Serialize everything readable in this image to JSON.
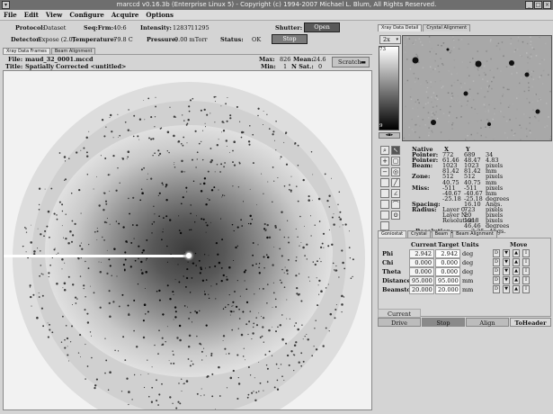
{
  "window": {
    "title": "marccd   v0.16.3b (Enterprise Linux 5) - Copyright (c) 1994-2007 Michael L. Blum, All Rights Reserved."
  },
  "menu": [
    "File",
    "Edit",
    "View",
    "Configure",
    "Acquire",
    "Options"
  ],
  "info": {
    "protocol_label": "Protocol:",
    "protocol_value": "Dataset",
    "seqfrm_label": "Seq:Frm:",
    "seqfrm_value": "40:6",
    "intensity_label": "Intensity:",
    "intensity_v1": "12837",
    "intensity_v2": "11295",
    "shutter_label": "Shutter:",
    "shutter_value": "Open",
    "detector_label": "Detector:",
    "detector_value": "Expose (2.0)",
    "temperature_label": "Temperature:",
    "temperature_value": "-79.8 C",
    "pressure_label": "Pressure:",
    "pressure_value": "0.00 mTorr",
    "status_label": "Status:",
    "status_value": "OK",
    "stop_label": "Stop"
  },
  "left_tabs": [
    "Xray Data Frames",
    "Beam Alignment"
  ],
  "file_info": {
    "file_label": "File:",
    "file_value": "maud_32_0001.mccd",
    "title_label": "Title:",
    "title_value": "Spatially Corrected <untitled>",
    "max_label": "Max:",
    "max_value": "826",
    "mean_label": "Mean:",
    "mean_value": "24.6",
    "min_label": "Min:",
    "min_value": "1",
    "nsat_label": "N Sat.:",
    "nsat_value": "0",
    "scale_label": "Scratch"
  },
  "right_tabs": [
    "Xray Data Detail",
    "Crystal Alignment"
  ],
  "zoom": {
    "value": "2x"
  },
  "colorbar": {
    "top": "73",
    "bottom": "9"
  },
  "pixel_info": {
    "col_native": "Native",
    "col_x": "X",
    "col_y": "Y",
    "rows": [
      {
        "label": "Pointer:",
        "a": "772",
        "b": "689",
        "c": "34"
      },
      {
        "label": "Pointer:",
        "a": "61.46",
        "b": "48.47",
        "c": "4.83"
      },
      {
        "label": "Beam:",
        "a": "1023",
        "b": "1023",
        "c": "pixels"
      },
      {
        "label": "",
        "a": "81.42",
        "b": "81.42",
        "c": "mm"
      },
      {
        "label": "Zone:",
        "a": "512",
        "b": "512",
        "c": "pixels"
      },
      {
        "label": "",
        "a": "40.75",
        "b": "40.75",
        "c": "mm"
      },
      {
        "label": "Miss:",
        "a": "-511",
        "b": "-511",
        "c": "pixels"
      },
      {
        "label": "",
        "a": "-40.67",
        "b": "-40.67",
        "c": "mm"
      },
      {
        "label": "",
        "a": "-25.18",
        "b": "-25.18",
        "c": "degrees"
      },
      {
        "label": "Spacing:",
        "a": "",
        "b": "16.10",
        "c": "Angs."
      },
      {
        "label": "Radius:",
        "a": "Layer 0:",
        "b": "723",
        "c": "pixels"
      },
      {
        "label": "",
        "a": "Layer N:",
        "b": "20",
        "c": "pixels"
      },
      {
        "label": "",
        "a": "Resolution:",
        "b": "1018",
        "c": "pixels"
      },
      {
        "label": "",
        "a": "",
        "b": "46.46",
        "c": "degrees"
      }
    ],
    "resolution_label": "Resolution:",
    "resolution_value": "2.25",
    "resolution_unit": "Angs."
  },
  "goniostat_tabs": [
    "Goniostat",
    "Crystal",
    "Beam",
    "Beam Alignment"
  ],
  "goniostat": {
    "headers": {
      "current": "Current",
      "target": "Target",
      "units": "Units",
      "move": "Move"
    },
    "rows": [
      {
        "name": "Phi",
        "current": "2.942",
        "target": "2.942",
        "units": "deg"
      },
      {
        "name": "Chi",
        "current": "0.000",
        "target": "0.000",
        "units": "deg"
      },
      {
        "name": "Theta",
        "current": "0.000",
        "target": "0.000",
        "units": "deg"
      },
      {
        "name": "Distance",
        "current": "95.000",
        "target": "95.000",
        "units": "mm"
      },
      {
        "name": "Beamstop",
        "current": "20.000",
        "target": "20.000",
        "units": "mm"
      }
    ]
  },
  "bottom": {
    "current_label": "Current",
    "drive": "Drive",
    "stop": "Stop",
    "align": "Align",
    "toheader": "ToHeader"
  }
}
